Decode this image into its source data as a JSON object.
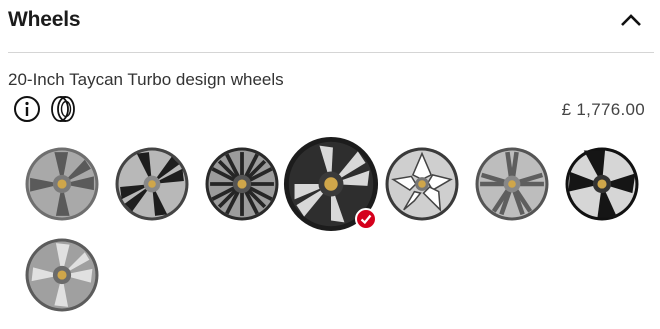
{
  "section": {
    "title": "Wheels",
    "collapse_icon": "chevron-up-icon"
  },
  "selected_wheel": {
    "name": "20-Inch Taycan Turbo design wheels",
    "price": "£ 1,776.00"
  },
  "action_icons": [
    "info-icon",
    "tyre-icon"
  ],
  "wheel_options": [
    {
      "id": "wheel-1",
      "selected": false
    },
    {
      "id": "wheel-2",
      "selected": false
    },
    {
      "id": "wheel-3",
      "selected": false
    },
    {
      "id": "wheel-4",
      "selected": true
    },
    {
      "id": "wheel-5",
      "selected": false
    },
    {
      "id": "wheel-6",
      "selected": false
    },
    {
      "id": "wheel-7",
      "selected": false
    },
    {
      "id": "wheel-8",
      "selected": false
    }
  ],
  "colors": {
    "accent_check": "#d5001c",
    "divider": "#d5d5d5"
  }
}
